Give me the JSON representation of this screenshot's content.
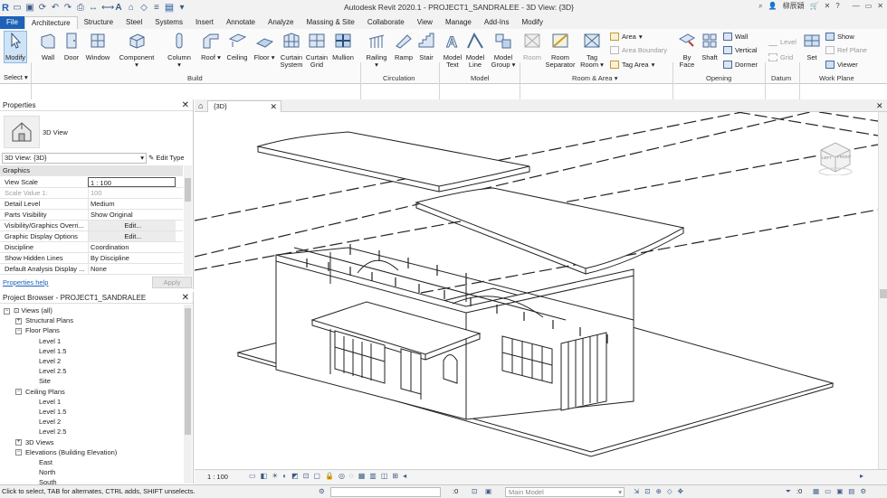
{
  "app": {
    "title": "Autodesk Revit 2020.1 - PROJECT1_SANDRALEE - 3D View: {3D}",
    "user": "柳辰穎"
  },
  "tabs": [
    "File",
    "Architecture",
    "Structure",
    "Steel",
    "Systems",
    "Insert",
    "Annotate",
    "Analyze",
    "Massing & Site",
    "Collaborate",
    "View",
    "Manage",
    "Add-Ins",
    "Modify"
  ],
  "ribbon": {
    "modify": "Modify",
    "wall": "Wall",
    "door": "Door",
    "window": "Window",
    "component": "Component",
    "column": "Column",
    "roof": "Roof",
    "ceiling": "Ceiling",
    "floor": "Floor",
    "curtain_system": [
      "Curtain",
      "System"
    ],
    "curtain_grid": [
      "Curtain",
      "Grid"
    ],
    "mullion": "Mullion",
    "railing": "Railing",
    "ramp": "Ramp",
    "stair": "Stair",
    "model_text": [
      "Model",
      "Text"
    ],
    "model_line": [
      "Model",
      "Line"
    ],
    "model_group": [
      "Model",
      "Group"
    ],
    "room": "Room",
    "room_separator": [
      "Room",
      "Separator"
    ],
    "tag_room": [
      "Tag",
      "Room"
    ],
    "area": "Area",
    "area_boundary": "Area Boundary",
    "tag_area": "Tag Area",
    "by_face": [
      "By",
      "Face"
    ],
    "shaft": "Shaft",
    "wall_small": "Wall",
    "vertical": "Vertical",
    "dormer": "Dormer",
    "level": "Level",
    "grid": "Grid",
    "set": "Set",
    "show": "Show",
    "ref_plane": "Ref Plane",
    "viewer": "Viewer",
    "panels": {
      "select": "Select",
      "build": "Build",
      "circulation": "Circulation",
      "model": "Model",
      "room_area": "Room & Area",
      "opening": "Opening",
      "datum": "Datum",
      "work_plane": "Work Plane"
    }
  },
  "properties": {
    "title": "Properties",
    "type_name": "3D View",
    "selector": "3D View: {3D}",
    "edit_type": "Edit Type",
    "group": "Graphics",
    "rows": [
      {
        "k": "View Scale",
        "v": "1 : 100"
      },
      {
        "k": "Scale Value    1:",
        "v": "100"
      },
      {
        "k": "Detail Level",
        "v": "Medium"
      },
      {
        "k": "Parts Visibility",
        "v": "Show Original"
      },
      {
        "k": "Visibility/Graphics Overri...",
        "v": "Edit..."
      },
      {
        "k": "Graphic Display Options",
        "v": "Edit..."
      },
      {
        "k": "Discipline",
        "v": "Coordination"
      },
      {
        "k": "Show Hidden Lines",
        "v": "By Discipline"
      },
      {
        "k": "Default Analysis Display ...",
        "v": "None"
      }
    ],
    "help": "Properties help",
    "apply": "Apply"
  },
  "browser": {
    "title": "Project Browser - PROJECT1_SANDRALEE",
    "nodes": [
      {
        "label": "Views (all)",
        "level": 0,
        "tog": "−"
      },
      {
        "label": "Structural Plans",
        "level": 1,
        "tog": "+"
      },
      {
        "label": "Floor Plans",
        "level": 1,
        "tog": "−"
      },
      {
        "label": "Level 1",
        "level": 2
      },
      {
        "label": "Level 1.5",
        "level": 2
      },
      {
        "label": "Level 2",
        "level": 2
      },
      {
        "label": "Level 2.5",
        "level": 2
      },
      {
        "label": "Site",
        "level": 2
      },
      {
        "label": "Ceiling Plans",
        "level": 1,
        "tog": "−"
      },
      {
        "label": "Level 1",
        "level": 2
      },
      {
        "label": "Level 1.5",
        "level": 2
      },
      {
        "label": "Level 2",
        "level": 2
      },
      {
        "label": "Level 2.5",
        "level": 2
      },
      {
        "label": "3D Views",
        "level": 1,
        "tog": "+"
      },
      {
        "label": "Elevations (Building Elevation)",
        "level": 1,
        "tog": "−"
      },
      {
        "label": "East",
        "level": 2
      },
      {
        "label": "North",
        "level": 2
      },
      {
        "label": "South",
        "level": 2
      }
    ]
  },
  "view": {
    "tab": "{3D}",
    "scale": "1 : 100",
    "viewcube_left": "LEFT",
    "viewcube_front": "FRONT"
  },
  "status": {
    "hint": "Click to select, TAB for alternates, CTRL adds, SHIFT unselects.",
    "zero": ":0",
    "model": "Main Model",
    "filter": ":0"
  }
}
